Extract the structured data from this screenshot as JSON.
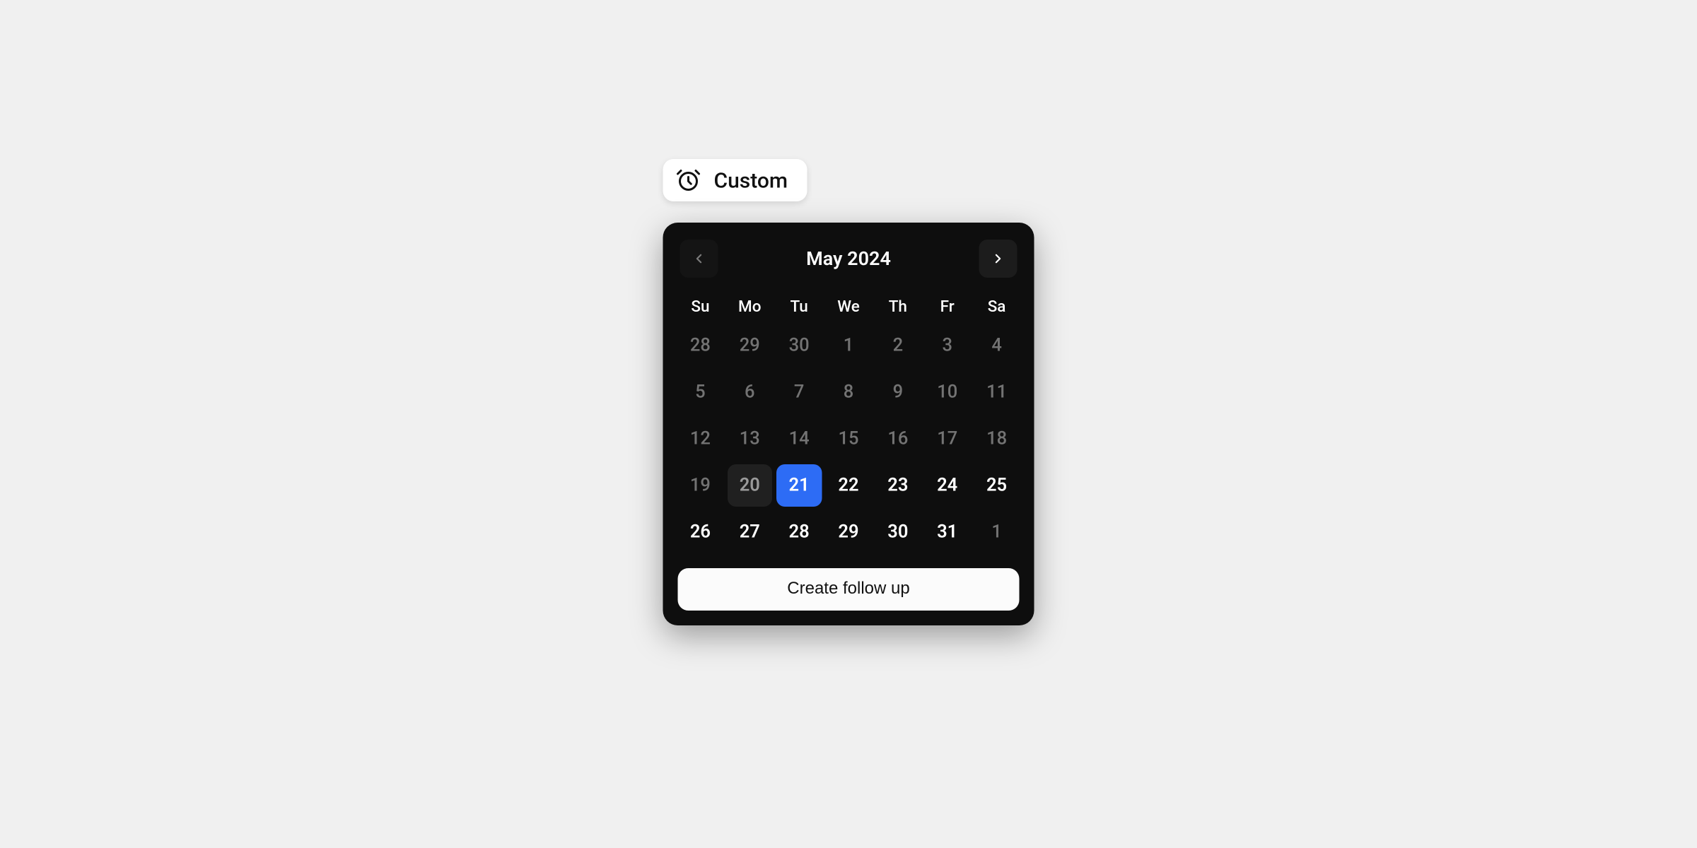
{
  "chip": {
    "label": "Custom"
  },
  "calendar": {
    "month_label": "May 2024",
    "weekdays": [
      "Su",
      "Mo",
      "Tu",
      "We",
      "Th",
      "Fr",
      "Sa"
    ],
    "days": [
      {
        "n": "28",
        "state": "muted"
      },
      {
        "n": "29",
        "state": "muted"
      },
      {
        "n": "30",
        "state": "muted"
      },
      {
        "n": "1",
        "state": "muted"
      },
      {
        "n": "2",
        "state": "muted"
      },
      {
        "n": "3",
        "state": "muted"
      },
      {
        "n": "4",
        "state": "muted"
      },
      {
        "n": "5",
        "state": "muted"
      },
      {
        "n": "6",
        "state": "muted"
      },
      {
        "n": "7",
        "state": "muted"
      },
      {
        "n": "8",
        "state": "muted"
      },
      {
        "n": "9",
        "state": "muted"
      },
      {
        "n": "10",
        "state": "muted"
      },
      {
        "n": "11",
        "state": "muted"
      },
      {
        "n": "12",
        "state": "muted"
      },
      {
        "n": "13",
        "state": "muted"
      },
      {
        "n": "14",
        "state": "muted"
      },
      {
        "n": "15",
        "state": "muted"
      },
      {
        "n": "16",
        "state": "muted"
      },
      {
        "n": "17",
        "state": "muted"
      },
      {
        "n": "18",
        "state": "muted"
      },
      {
        "n": "19",
        "state": "muted"
      },
      {
        "n": "20",
        "state": "today"
      },
      {
        "n": "21",
        "state": "selected"
      },
      {
        "n": "22",
        "state": "normal"
      },
      {
        "n": "23",
        "state": "normal"
      },
      {
        "n": "24",
        "state": "normal"
      },
      {
        "n": "25",
        "state": "normal"
      },
      {
        "n": "26",
        "state": "normal"
      },
      {
        "n": "27",
        "state": "normal"
      },
      {
        "n": "28",
        "state": "normal"
      },
      {
        "n": "29",
        "state": "normal"
      },
      {
        "n": "30",
        "state": "normal"
      },
      {
        "n": "31",
        "state": "normal"
      },
      {
        "n": "1",
        "state": "muted"
      }
    ],
    "create_label": "Create follow up",
    "prev_disabled": true
  },
  "colors": {
    "accent": "#2d6cf5",
    "panel": "#0e0e0e"
  }
}
